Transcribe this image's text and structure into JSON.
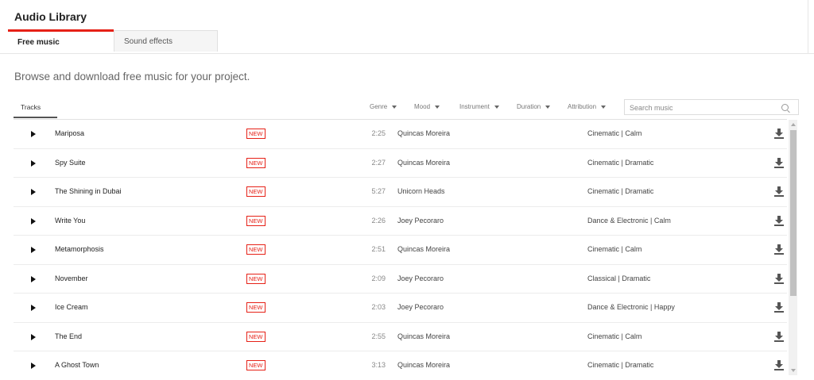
{
  "app": {
    "title": "Audio Library"
  },
  "tabs": [
    {
      "label": "Free music",
      "active": true
    },
    {
      "label": "Sound effects",
      "active": false
    }
  ],
  "subtitle": "Browse and download free music for your project.",
  "tracks_tab": "Tracks",
  "filters": [
    {
      "label": "Genre"
    },
    {
      "label": "Mood"
    },
    {
      "label": "Instrument"
    },
    {
      "label": "Duration"
    },
    {
      "label": "Attribution"
    }
  ],
  "search": {
    "placeholder": "Search music",
    "value": ""
  },
  "badge_label": "NEW",
  "tracks": [
    {
      "title": "Mariposa",
      "duration": "2:25",
      "artist": "Quincas Moreira",
      "genre_mood": "Cinematic | Calm"
    },
    {
      "title": "Spy Suite",
      "duration": "2:27",
      "artist": "Quincas Moreira",
      "genre_mood": "Cinematic | Dramatic"
    },
    {
      "title": "The Shining in Dubai",
      "duration": "5:27",
      "artist": "Unicorn Heads",
      "genre_mood": "Cinematic | Dramatic"
    },
    {
      "title": "Write You",
      "duration": "2:26",
      "artist": "Joey Pecoraro",
      "genre_mood": "Dance & Electronic | Calm"
    },
    {
      "title": "Metamorphosis",
      "duration": "2:51",
      "artist": "Quincas Moreira",
      "genre_mood": "Cinematic | Calm"
    },
    {
      "title": "November",
      "duration": "2:09",
      "artist": "Joey Pecoraro",
      "genre_mood": "Classical | Dramatic"
    },
    {
      "title": "Ice Cream",
      "duration": "2:03",
      "artist": "Joey Pecoraro",
      "genre_mood": "Dance & Electronic | Happy"
    },
    {
      "title": "The End",
      "duration": "2:55",
      "artist": "Quincas Moreira",
      "genre_mood": "Cinematic | Calm"
    },
    {
      "title": "A Ghost Town",
      "duration": "3:13",
      "artist": "Quincas Moreira",
      "genre_mood": "Cinematic | Dramatic"
    }
  ],
  "colors": {
    "accent": "#e62117"
  }
}
